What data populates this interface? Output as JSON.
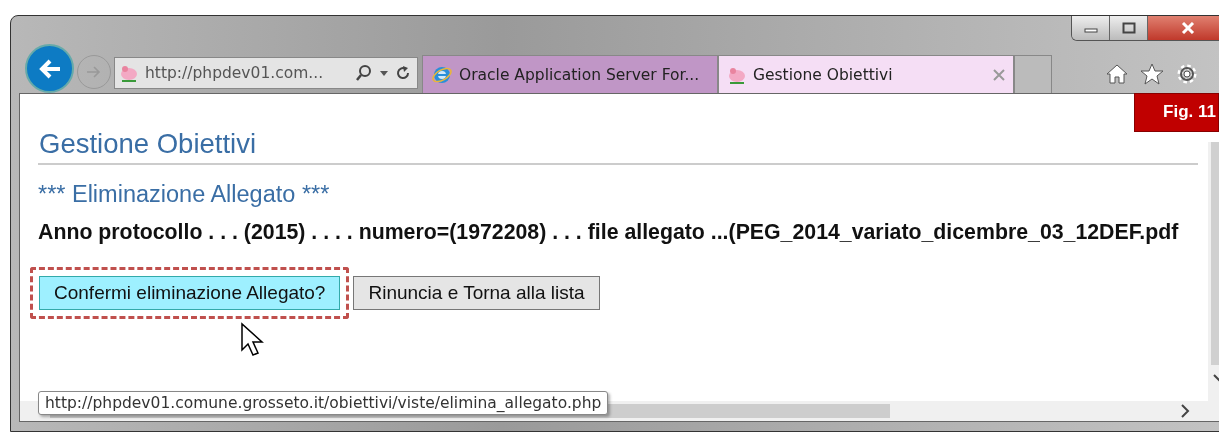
{
  "address_bar": {
    "url": "http://phpdev01.com..."
  },
  "tabs": [
    {
      "title": "Oracle Application Server For...",
      "selected": false
    },
    {
      "title": "Gestione Obiettivi",
      "selected": true
    }
  ],
  "figure_label": "Fig. 11",
  "page": {
    "title": "Gestione Obiettivi",
    "subtitle": "*** Eliminazione Allegato ***",
    "info": "Anno protocollo . . . (2015) . . . . numero=(1972208) . . . file allegato ...(PEG_2014_variato_dicembre_03_12DEF.pdf",
    "buttons": [
      {
        "label": "Confermi eliminazione Allegato?",
        "highlighted": true
      },
      {
        "label": "Rinuncia e Torna alla lista",
        "highlighted": false
      }
    ]
  },
  "status_url": "http://phpdev01.comune.grosseto.it/obiettivi/viste/elimina_allegato.php"
}
